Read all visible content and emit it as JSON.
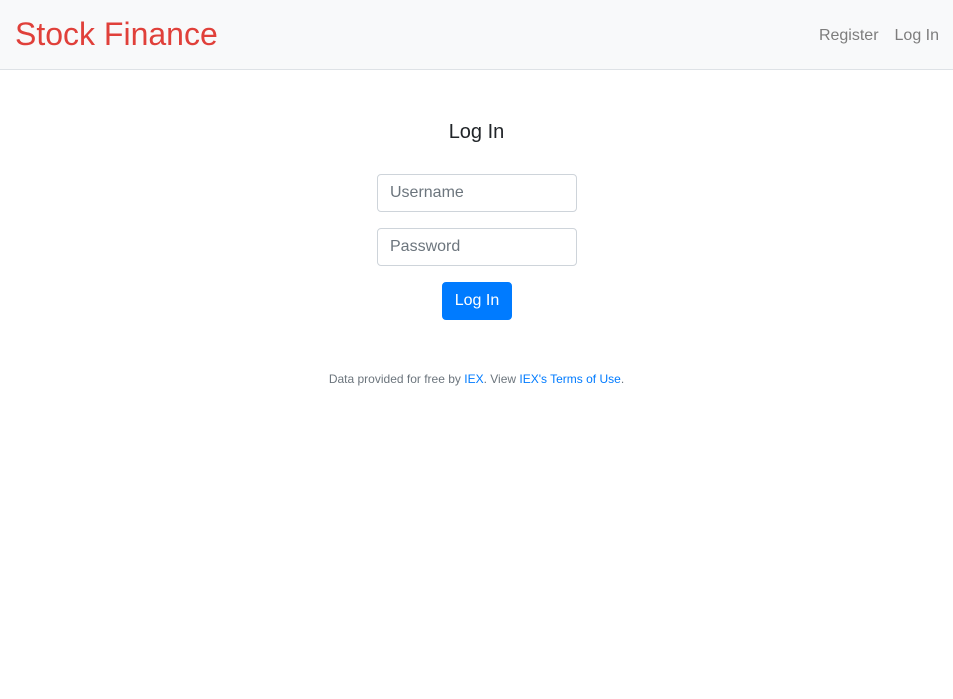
{
  "navbar": {
    "brand": "Stock Finance",
    "links": [
      {
        "label": "Register"
      },
      {
        "label": "Log In"
      }
    ]
  },
  "login": {
    "title": "Log In",
    "username_placeholder": "Username",
    "password_placeholder": "Password",
    "submit_label": "Log In"
  },
  "footer": {
    "text_before": "Data provided for free by ",
    "iex_link": "IEX",
    "text_middle": ". View ",
    "terms_link": "IEX's Terms of Use",
    "text_after": "."
  },
  "colors": {
    "brand": "#e0403a",
    "primary": "#007bff",
    "navbar_bg": "#f8f9fa"
  }
}
